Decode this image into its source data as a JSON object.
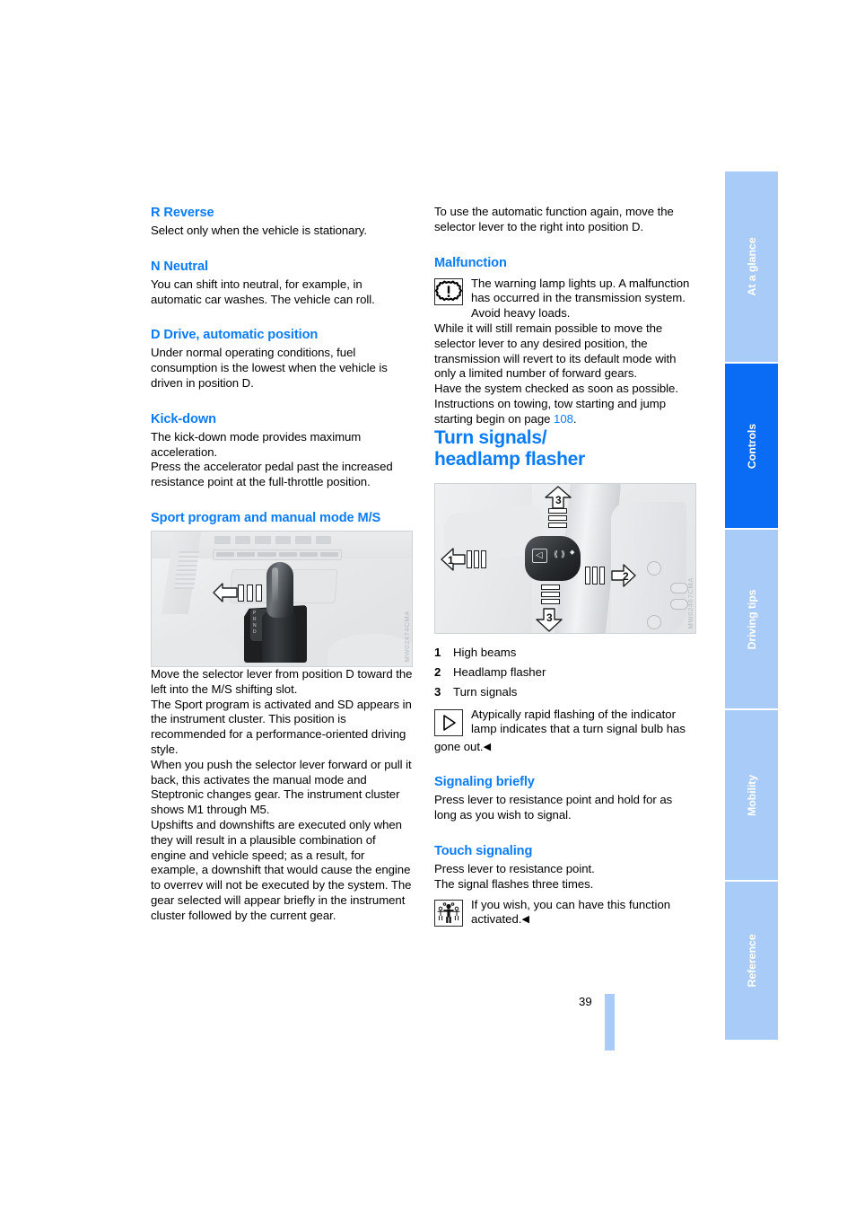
{
  "page": {
    "number": "39"
  },
  "left_column": {
    "s_reverse": {
      "heading": "R Reverse",
      "body": "Select only when the vehicle is stationary."
    },
    "s_neutral": {
      "heading": "N Neutral",
      "body": "You can shift into neutral, for example, in automatic car washes. The vehicle can roll."
    },
    "s_drive": {
      "heading": "D Drive, automatic position",
      "body": "Under normal operating conditions, fuel consumption is the lowest when the vehicle is driven in position D."
    },
    "s_kickdown": {
      "heading": "Kick-down",
      "body1": "The kick-down mode provides maximum acceleration.",
      "body2": "Press the accelerator pedal past the increased resistance point at the full-throttle position."
    },
    "s_sport": {
      "heading": "Sport program and manual mode M/S",
      "figure_code": "MW02474CMA",
      "body1": "Move the selector lever from position D toward the left into the M/S shifting slot.",
      "body2": "The Sport program is activated and SD appears in the instrument cluster. This position is recommended for a performance-oriented driving style.",
      "body3": "When you push the selector lever forward or pull it back, this activates the manual mode and Steptronic changes gear. The instrument cluster shows M1 through M5.",
      "body4": "Upshifts and downshifts are executed only when they will result in a plausible combination of engine and vehicle speed; as a result, for example, a downshift that would cause the engine to overrev will not be executed by the system. The gear selected will appear briefly in the instrument cluster followed by the current gear."
    }
  },
  "right_column": {
    "intro": "To use the automatic function again, move the selector lever to the right into position D.",
    "s_malfunction": {
      "heading": "Malfunction",
      "note_icon": "transmission-warning-icon",
      "note": "The warning lamp lights up. A malfunction has occurred in the transmission system. Avoid heavy loads.",
      "body1": "While it will still remain possible to move the selector lever to any desired position, the transmission will revert to its default mode with only a limited number of forward gears.",
      "body2": "Have the system checked as soon as possible.",
      "body3_pre": "Instructions on towing, tow starting and jump starting begin on page ",
      "body3_link": "108",
      "body3_post": "."
    },
    "s_turn": {
      "heading_line1": "Turn signals/",
      "heading_line2": "headlamp flasher",
      "figure_code": "MW02467CMA",
      "legend": [
        {
          "num": "1",
          "label": "High beams"
        },
        {
          "num": "2",
          "label": "Headlamp flasher"
        },
        {
          "num": "3",
          "label": "Turn signals"
        }
      ],
      "note_icon": "note-triangle-icon",
      "note_line1": "Atypically rapid flashing of the indicator lamp indicates that a turn signal bulb has",
      "note_line2": "gone out.",
      "note_end": "◀"
    },
    "s_signaling": {
      "heading": "Signaling briefly",
      "body": "Press lever to resistance point and hold for as long as you wish to signal."
    },
    "s_touch": {
      "heading": "Touch signaling",
      "body1": "Press lever to resistance point.",
      "body2": "The signal flashes three times.",
      "note_icon": "service-figures-icon",
      "note": "If you wish, you can have this function activated.",
      "note_end": "◀"
    }
  },
  "figure_labels": {
    "stalk_1": "1",
    "stalk_2": "2",
    "stalk_3_top": "3",
    "stalk_3_bottom": "3",
    "gate_letters": "P R N D"
  },
  "sidebar": {
    "tabs": [
      {
        "label": "At a glance",
        "active": false
      },
      {
        "label": "Controls",
        "active": true
      },
      {
        "label": "Driving tips",
        "active": false
      },
      {
        "label": "Mobility",
        "active": false
      },
      {
        "label": "Reference",
        "active": false
      }
    ]
  },
  "colors": {
    "accent": "#0a7cf5",
    "tab_active": "#0a6bf5",
    "tab_inactive": "#a9cbf7",
    "text": "#000000"
  }
}
